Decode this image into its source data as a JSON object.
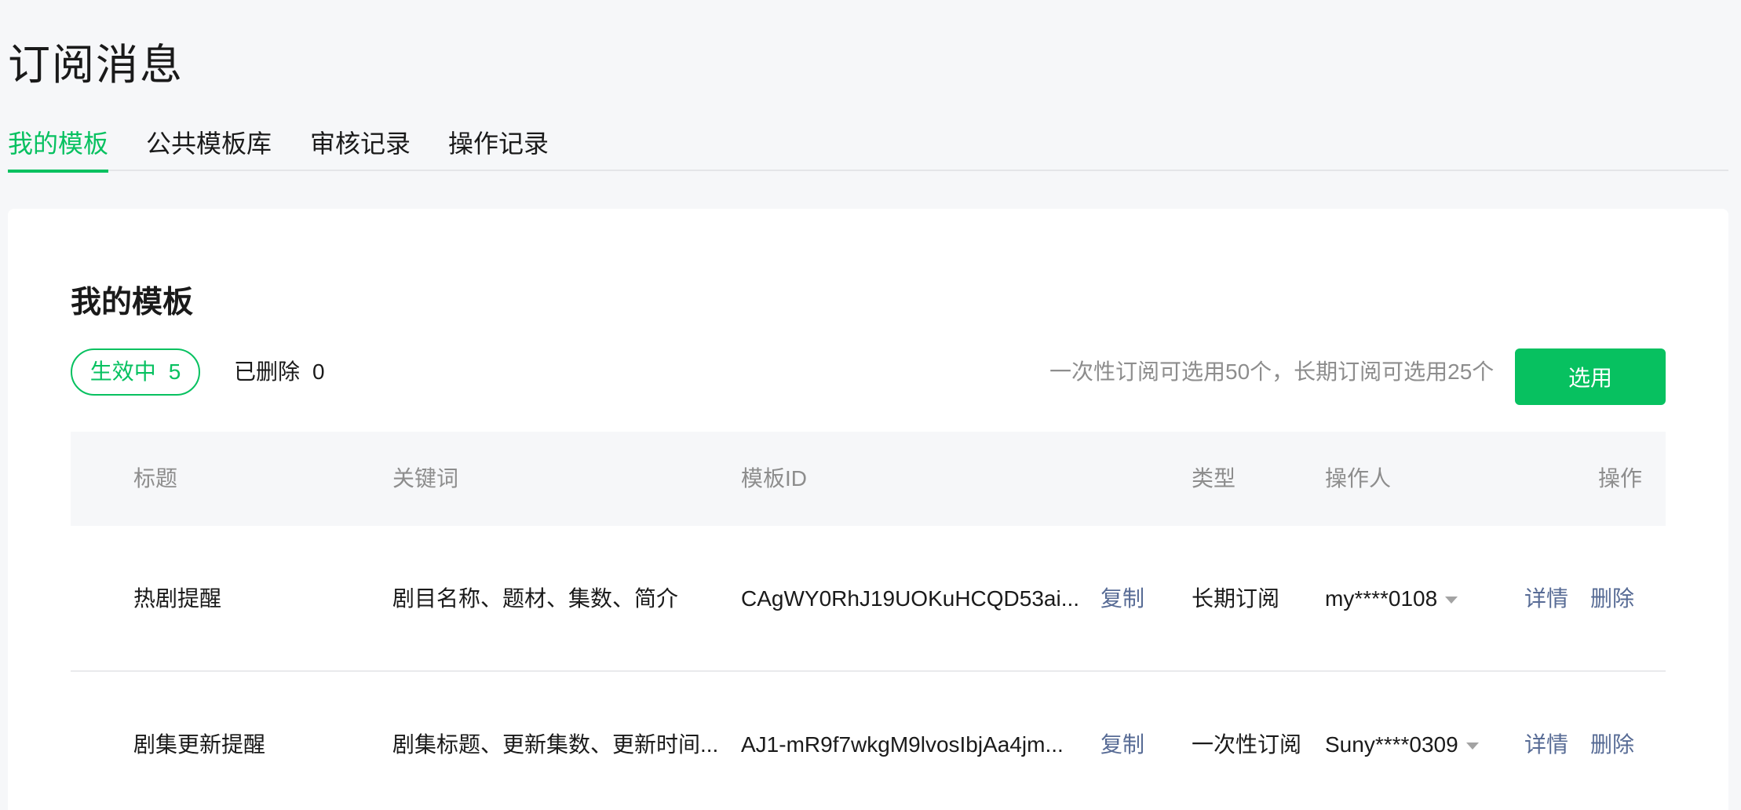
{
  "page": {
    "title": "订阅消息"
  },
  "tabs": [
    {
      "label": "我的模板",
      "active": true
    },
    {
      "label": "公共模板库",
      "active": false
    },
    {
      "label": "审核记录",
      "active": false
    },
    {
      "label": "操作记录",
      "active": false
    }
  ],
  "section": {
    "title": "我的模板",
    "filters": {
      "active": {
        "label": "生效中",
        "count": "5"
      },
      "deleted": {
        "label": "已删除",
        "count": "0"
      }
    },
    "quota_note": "一次性订阅可选用50个，长期订阅可选用25个",
    "select_button": "选用"
  },
  "table": {
    "columns": {
      "title": "标题",
      "keywords": "关键词",
      "template_id": "模板ID",
      "type": "类型",
      "operator": "操作人",
      "actions": "操作"
    },
    "rows": [
      {
        "title": "热剧提醒",
        "keywords": "剧目名称、题材、集数、简介",
        "template_id": "CAgWY0RhJ19UOKuHCQD53ai...",
        "copy": "复制",
        "type": "长期订阅",
        "operator": "my****0108",
        "detail": "详情",
        "delete": "删除"
      },
      {
        "title": "剧集更新提醒",
        "keywords": "剧集标题、更新集数、更新时间...",
        "template_id": "AJ1-mR9f7wkgM9lvosIbjAa4jm...",
        "copy": "复制",
        "type": "一次性订阅",
        "operator": "Suny****0309",
        "detail": "详情",
        "delete": "删除"
      }
    ]
  },
  "colors": {
    "accent": "#07c160",
    "link": "#576b95",
    "muted": "#8d8d8d",
    "background": "#f6f7f9"
  }
}
